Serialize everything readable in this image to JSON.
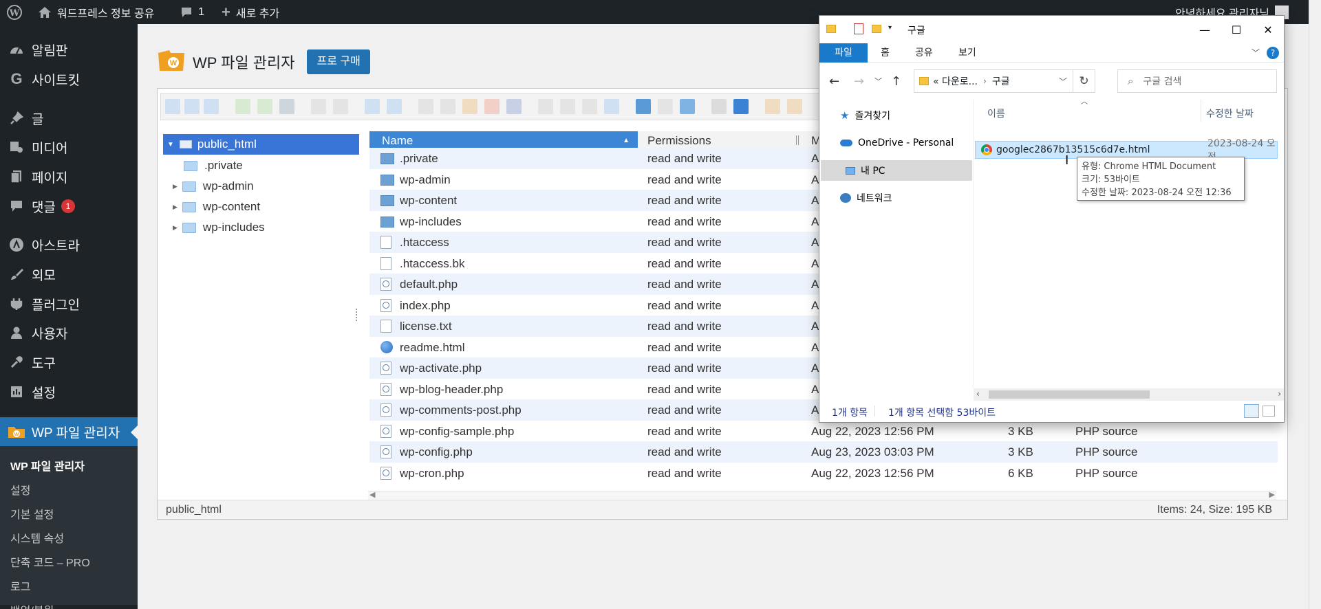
{
  "adminbar": {
    "site_name": "워드프레스 정보 공유",
    "comments_count": "1",
    "new_label": "새로 추가",
    "greeting": "안녕하세요 관리자님"
  },
  "sidebar": {
    "items": [
      {
        "label": "알림판",
        "icon": "dashboard-icon"
      },
      {
        "label": "사이트킷",
        "icon": "google-g-icon"
      },
      {
        "label": "글",
        "icon": "pin-icon"
      },
      {
        "label": "미디어",
        "icon": "media-icon"
      },
      {
        "label": "페이지",
        "icon": "page-icon"
      },
      {
        "label": "댓글",
        "icon": "comment-icon",
        "badge": "1"
      },
      {
        "label": "아스트라",
        "icon": "astra-icon"
      },
      {
        "label": "외모",
        "icon": "brush-icon"
      },
      {
        "label": "플러그인",
        "icon": "plugin-icon"
      },
      {
        "label": "사용자",
        "icon": "user-icon"
      },
      {
        "label": "도구",
        "icon": "wrench-icon"
      },
      {
        "label": "설정",
        "icon": "settings-icon"
      },
      {
        "label": "WP 파일 관리자",
        "icon": "wp-file-manager-icon"
      }
    ],
    "submenu": [
      "WP 파일 관리자",
      "설정",
      "기본 설정",
      "시스템 속성",
      "단축 코드 – PRO",
      "로그",
      "백업/복원"
    ]
  },
  "page": {
    "title": "WP 파일 관리자",
    "pro_button": "프로 구매"
  },
  "file_manager": {
    "tree_root": "public_html",
    "tree": [
      ".private",
      "wp-admin",
      "wp-content",
      "wp-includes"
    ],
    "columns": {
      "name": "Name",
      "permissions": "Permissions",
      "modified": "Mo"
    },
    "rows": [
      {
        "name": ".private",
        "type": "dir",
        "perm": "read and write",
        "date": "Aug",
        "size": "",
        "kind": ""
      },
      {
        "name": "wp-admin",
        "type": "dir",
        "perm": "read and write",
        "date": "Aug",
        "size": "",
        "kind": ""
      },
      {
        "name": "wp-content",
        "type": "dir",
        "perm": "read and write",
        "date": "Aug",
        "size": "",
        "kind": ""
      },
      {
        "name": "wp-includes",
        "type": "dir",
        "perm": "read and write",
        "date": "Aug",
        "size": "",
        "kind": ""
      },
      {
        "name": ".htaccess",
        "type": "txt",
        "perm": "read and write",
        "date": "Aug",
        "size": "",
        "kind": ""
      },
      {
        "name": ".htaccess.bk",
        "type": "txt",
        "perm": "read and write",
        "date": "Aug",
        "size": "",
        "kind": ""
      },
      {
        "name": "default.php",
        "type": "php",
        "perm": "read and write",
        "date": "Aug",
        "size": "",
        "kind": ""
      },
      {
        "name": "index.php",
        "type": "php",
        "perm": "read and write",
        "date": "Aug",
        "size": "",
        "kind": ""
      },
      {
        "name": "license.txt",
        "type": "txt",
        "perm": "read and write",
        "date": "Aug",
        "size": "",
        "kind": ""
      },
      {
        "name": "readme.html",
        "type": "web",
        "perm": "read and write",
        "date": "Aug",
        "size": "",
        "kind": ""
      },
      {
        "name": "wp-activate.php",
        "type": "php",
        "perm": "read and write",
        "date": "Aug",
        "size": "",
        "kind": ""
      },
      {
        "name": "wp-blog-header.php",
        "type": "php",
        "perm": "read and write",
        "date": "Aug",
        "size": "",
        "kind": ""
      },
      {
        "name": "wp-comments-post.php",
        "type": "php",
        "perm": "read and write",
        "date": "Aug",
        "size": "",
        "kind": ""
      },
      {
        "name": "wp-config-sample.php",
        "type": "php",
        "perm": "read and write",
        "date": "Aug 22, 2023 12:56 PM",
        "size": "3 KB",
        "kind": "PHP source"
      },
      {
        "name": "wp-config.php",
        "type": "php",
        "perm": "read and write",
        "date": "Aug 23, 2023 03:03 PM",
        "size": "3 KB",
        "kind": "PHP source"
      },
      {
        "name": "wp-cron.php",
        "type": "php",
        "perm": "read and write",
        "date": "Aug 22, 2023 12:56 PM",
        "size": "6 KB",
        "kind": "PHP source"
      }
    ],
    "status_path": "public_html",
    "status_info": "Items: 24, Size: 195 KB"
  },
  "explorer": {
    "title": "구글",
    "ribbon_tabs": [
      "파일",
      "홈",
      "공유",
      "보기"
    ],
    "address": [
      "« 다운로...",
      "구글"
    ],
    "search_placeholder": "구글 검색",
    "nav_items": [
      "즐겨찾기",
      "OneDrive - Personal",
      "내 PC",
      "네트워크"
    ],
    "col_name": "이름",
    "col_date": "수정한 날짜",
    "file": {
      "name": "googlec2867b13515c6d7e.html",
      "date": "2023-08-24 오전"
    },
    "tooltip": [
      "유형: Chrome HTML Document",
      "크기: 53바이트",
      "수정한 날짜: 2023-08-24 오전 12:36"
    ],
    "status_count": "1개 항목",
    "status_selected": "1개 항목 선택함 53바이트"
  }
}
